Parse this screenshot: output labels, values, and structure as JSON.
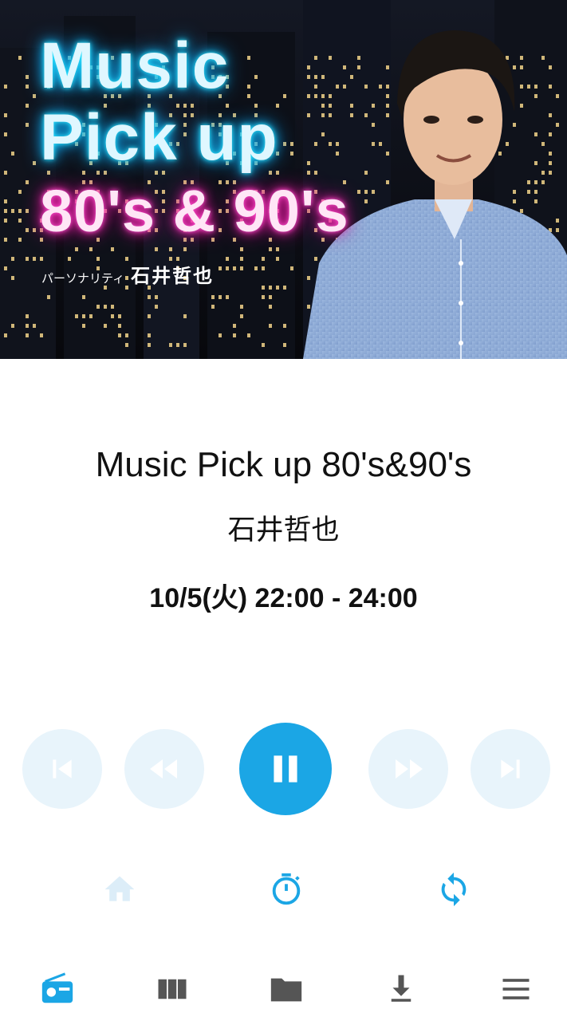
{
  "banner": {
    "title_line1": "Music",
    "title_line2": "Pick up",
    "title_line3": "80's & 90's",
    "personality_label": "パーソナリティ",
    "personality_name": "石井哲也"
  },
  "program": {
    "title": "Music Pick up 80's&90's",
    "host": "石井哲也",
    "airtime": "10/5(火)  22:00 - 24:00"
  },
  "player": {
    "state": "playing",
    "controls": [
      "skip-previous-icon",
      "rewind-icon",
      "pause-icon",
      "fast-forward-icon",
      "skip-next-icon"
    ]
  },
  "utilities": [
    "home-icon",
    "timer-icon",
    "sync-icon"
  ],
  "bottom_nav": {
    "active": "radio",
    "items": [
      "radio-icon",
      "columns-icon",
      "folder-icon",
      "download-icon",
      "menu-icon"
    ]
  },
  "colors": {
    "accent": "#1ba6e5",
    "inactive_control_bg": "#e8f4fb",
    "inactive_icon": "#ffffff",
    "nav_icon": "#555555"
  }
}
